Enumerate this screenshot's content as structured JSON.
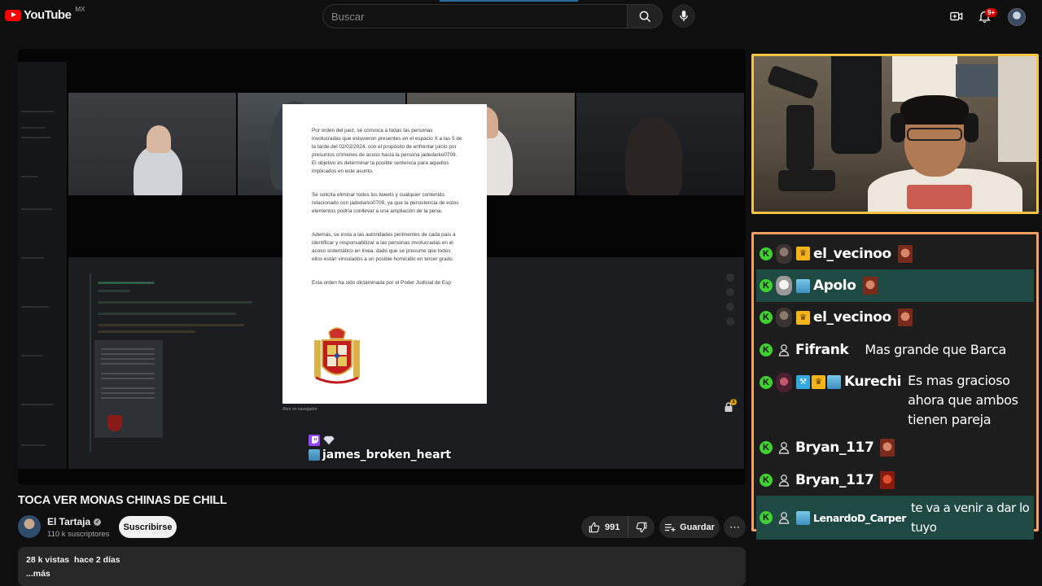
{
  "header": {
    "logo_text": "YouTube",
    "region": "MX",
    "search_placeholder": "Buscar",
    "notifications_badge": "9+"
  },
  "video": {
    "document": {
      "paragraphs": [
        "Por orden del juez, se convoca a todas las personas involucradas que estuvieron presentes en el espacio X a las 5 de la tarde del 02/02/2024, con el propósito de enfrentar juicio por presuntos crímenes de acoso hacia la persona jadedarko0709. El objetivo es determinar la posible sentencia para aquellos implicados en este asunto.",
        "Se solicita eliminar todos los tweets y cualquier contenido relacionado con jadedarko0709, ya que la persistencia de estos elementos podría conllevar a una ampliación de la pena.",
        "Además, se insta a las autoridades pertinentes de cada país a identificar y responsabilizar a las personas involucradas en el acoso sistemático en línea, dado que se presume que todos ellos están vinculados a un posible homicidio en tercer grado.",
        "Esta orden ha sido dictaminada por el Poder Judicial de Esp"
      ],
      "caption": "Abrir en navegador"
    },
    "overlay_username": "james_broken_heart",
    "lock_badge": "1"
  },
  "chat": {
    "messages": [
      {
        "user": "el_vecinoo",
        "badges": [
          "crown"
        ],
        "text": "",
        "emote": true,
        "highlight": false
      },
      {
        "user": "Apolo",
        "badges": [
          "sub"
        ],
        "text": "",
        "emote": true,
        "highlight": true
      },
      {
        "user": "el_vecinoo",
        "badges": [
          "crown"
        ],
        "text": "",
        "emote": true,
        "highlight": false
      },
      {
        "user": "Fifrank",
        "badges": [],
        "text": "Mas grande que Barca",
        "emote": false,
        "highlight": false
      },
      {
        "user": "Kurechi",
        "badges": [
          "hammer",
          "crown",
          "sub"
        ],
        "text": "Es mas gracioso ahora que ambos tienen pareja",
        "emote": false,
        "highlight": true
      },
      {
        "user": "Bryan_117",
        "badges": [],
        "text": "",
        "emote": true,
        "highlight": false
      },
      {
        "user": "Bryan_117",
        "badges": [],
        "text": "",
        "emote": true,
        "highlight": false
      },
      {
        "user": "LenardoD_Carper",
        "badges": [
          "sub"
        ],
        "text": "te va a venir a dar lo tuyo",
        "emote": false,
        "highlight": true
      }
    ],
    "colors": {
      "kick_green": "#3fd12f",
      "highlight": "#1f4a44",
      "border": "#f5a060"
    }
  },
  "info": {
    "title": "TOCA VER MONAS CHINAS DE CHILL",
    "channel_name": "El Tartaja",
    "subscribers": "110 k suscriptores",
    "subscribe_label": "Suscribirse",
    "likes": "991",
    "save_label": "Guardar",
    "views": "28 k vistas",
    "date": "hace 2 días",
    "more": "...más"
  }
}
